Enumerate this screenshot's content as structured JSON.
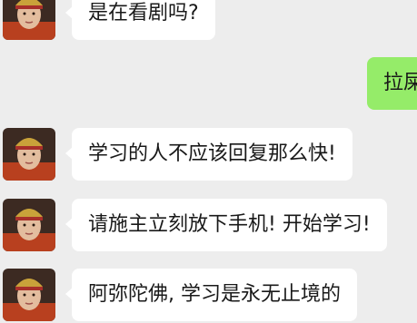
{
  "chat": {
    "messages": [
      {
        "sender": "other",
        "text": "是在看剧吗?"
      },
      {
        "sender": "self",
        "text": "拉屎"
      },
      {
        "sender": "other",
        "text": "学习的人不应该回复那么快!"
      },
      {
        "sender": "other",
        "text": "请施主立刻放下手机! 开始学习!"
      },
      {
        "sender": "other",
        "text": "阿弥陀佛, 学习是永无止境的"
      }
    ]
  },
  "colors": {
    "background": "#ededed",
    "incoming_bubble": "#ffffff",
    "outgoing_bubble": "#95ec69",
    "text": "#191919"
  },
  "icons": {
    "avatar": "monk-portrait-avatar"
  }
}
